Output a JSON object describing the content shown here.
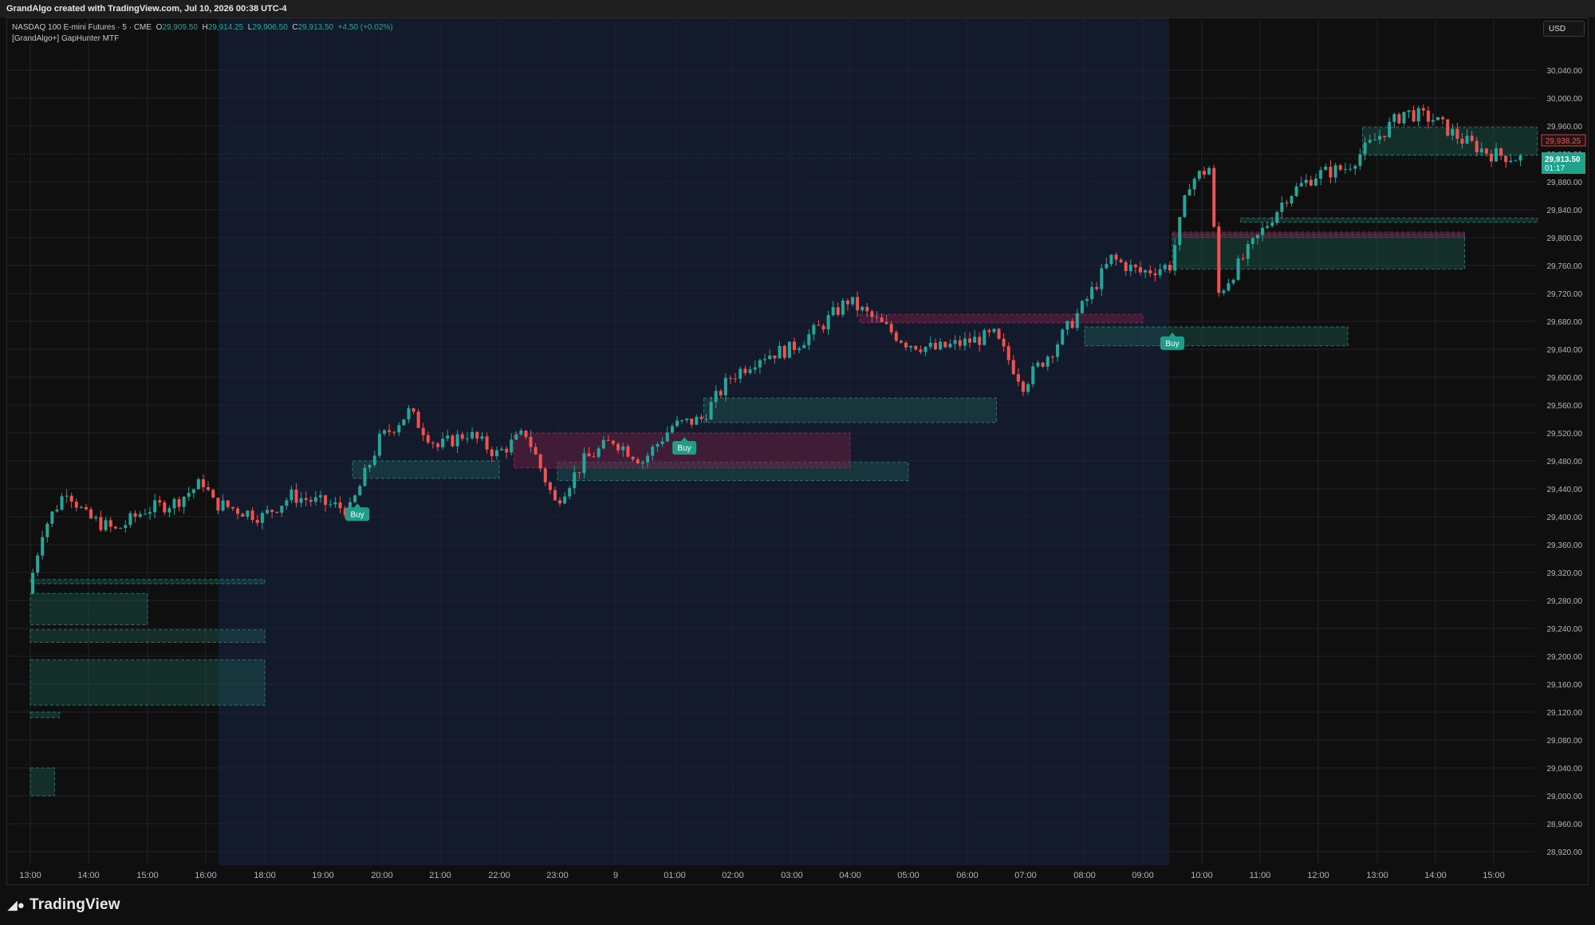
{
  "header": {
    "attribution": "GrandAlgo created with TradingView.com, Jul 10, 2026 00:38 UTC-4"
  },
  "legend": {
    "symbol": "NASDAQ 100 E-mini Futures · 5 · CME",
    "open_label": "O",
    "open": "29,909.50",
    "high_label": "H",
    "high": "29,914.25",
    "low_label": "L",
    "low": "29,906.50",
    "close_label": "C",
    "close": "29,913.50",
    "change": "+4.50 (+0.02%)",
    "indicator": "[GrandAlgo+] GapHunter MTF"
  },
  "currency_button": "USD",
  "footer": {
    "logo_text": "TradingView"
  },
  "price_tags": {
    "red_price": "29,938.25",
    "last_price": "29,913.50",
    "countdown": "01:17"
  },
  "colors": {
    "up": "#26a69a",
    "down": "#ef5350",
    "bull_zone": "#1f6b5c",
    "bear_zone": "#7a1f48",
    "session_bg": "#131a2b",
    "buy_label": "#1f9d89"
  },
  "chart_data": {
    "type": "candlestick",
    "y_axis_labels": [
      "30,040.00",
      "30,000.00",
      "29,960.00",
      "29,920.00",
      "29,880.00",
      "29,840.00",
      "29,800.00",
      "29,760.00",
      "29,720.00",
      "29,680.00",
      "29,640.00",
      "29,600.00",
      "29,560.00",
      "29,520.00",
      "29,480.00",
      "29,440.00",
      "29,400.00",
      "29,360.00",
      "29,320.00",
      "29,280.00",
      "29,240.00",
      "29,200.00",
      "29,160.00",
      "29,120.00",
      "29,080.00",
      "29,040.00",
      "29,000.00",
      "28,960.00",
      "28,920.00"
    ],
    "x_axis_labels": [
      "13:00",
      "14:00",
      "15:00",
      "16:00",
      "18:00",
      "19:00",
      "20:00",
      "21:00",
      "22:00",
      "23:00",
      "9",
      "01:00",
      "02:00",
      "03:00",
      "04:00",
      "05:00",
      "06:00",
      "07:00",
      "08:00",
      "09:00",
      "10:00",
      "11:00",
      "12:00",
      "13:00",
      "14:00",
      "15:00"
    ],
    "ylim": [
      28905,
      30070
    ],
    "path": [
      {
        "t": "13:00",
        "p": 29290
      },
      {
        "t": "13:15",
        "p": 29380
      },
      {
        "t": "13:40",
        "p": 29440
      },
      {
        "t": "14:00",
        "p": 29400
      },
      {
        "t": "14:30",
        "p": 29380
      },
      {
        "t": "15:00",
        "p": 29410
      },
      {
        "t": "15:30",
        "p": 29420
      },
      {
        "t": "16:00",
        "p": 29450
      },
      {
        "t": "16:10",
        "p": 29420
      },
      {
        "t": "18:00",
        "p": 29400
      },
      {
        "t": "18:30",
        "p": 29430
      },
      {
        "t": "19:00",
        "p": 29420
      },
      {
        "t": "19:30",
        "p": 29410
      },
      {
        "t": "20:00",
        "p": 29510
      },
      {
        "t": "20:30",
        "p": 29550
      },
      {
        "t": "21:00",
        "p": 29500
      },
      {
        "t": "21:30",
        "p": 29520
      },
      {
        "t": "22:00",
        "p": 29490
      },
      {
        "t": "22:30",
        "p": 29520
      },
      {
        "t": "23:00",
        "p": 29420
      },
      {
        "t": "23:30",
        "p": 29480
      },
      {
        "t": "9",
        "p": 29510
      },
      {
        "t": "00:30",
        "p": 29480
      },
      {
        "t": "01:00",
        "p": 29530
      },
      {
        "t": "01:30",
        "p": 29540
      },
      {
        "t": "02:00",
        "p": 29600
      },
      {
        "t": "02:30",
        "p": 29630
      },
      {
        "t": "03:00",
        "p": 29640
      },
      {
        "t": "03:30",
        "p": 29670
      },
      {
        "t": "04:00",
        "p": 29710
      },
      {
        "t": "04:20",
        "p": 29690
      },
      {
        "t": "05:00",
        "p": 29650
      },
      {
        "t": "05:30",
        "p": 29640
      },
      {
        "t": "06:00",
        "p": 29650
      },
      {
        "t": "06:30",
        "p": 29660
      },
      {
        "t": "07:00",
        "p": 29590
      },
      {
        "t": "07:30",
        "p": 29640
      },
      {
        "t": "08:00",
        "p": 29700
      },
      {
        "t": "08:30",
        "p": 29770
      },
      {
        "t": "09:00",
        "p": 29750
      },
      {
        "t": "09:30",
        "p": 29760
      },
      {
        "t": "09:50",
        "p": 29880
      },
      {
        "t": "10:10",
        "p": 29900
      },
      {
        "t": "10:20",
        "p": 29720
      },
      {
        "t": "10:40",
        "p": 29760
      },
      {
        "t": "11:00",
        "p": 29800
      },
      {
        "t": "11:30",
        "p": 29860
      },
      {
        "t": "12:00",
        "p": 29890
      },
      {
        "t": "12:30",
        "p": 29900
      },
      {
        "t": "13:00",
        "p": 29940
      },
      {
        "t": "13:30",
        "p": 29980
      },
      {
        "t": "14:00",
        "p": 29970
      },
      {
        "t": "14:30",
        "p": 29940
      },
      {
        "t": "15:00",
        "p": 29920
      },
      {
        "t": "15:30",
        "p": 29914
      }
    ],
    "zones": [
      {
        "kind": "bull",
        "from": "13:00",
        "to": "15:00",
        "top": 29290,
        "bottom": 29245
      },
      {
        "kind": "bull",
        "from": "13:00",
        "to": "18:00",
        "top": 29195,
        "bottom": 29130
      },
      {
        "kind": "bull",
        "from": "13:00",
        "to": "18:00",
        "top": 29238,
        "bottom": 29220
      },
      {
        "kind": "bull",
        "from": "13:00",
        "to": "18:00",
        "top": 29310,
        "bottom": 29304
      },
      {
        "kind": "bull",
        "from": "13:00",
        "to": "13:30",
        "top": 29120,
        "bottom": 29112
      },
      {
        "kind": "bull",
        "from": "13:00",
        "to": "13:25",
        "top": 29040,
        "bottom": 29000
      },
      {
        "kind": "bull",
        "from": "19:30",
        "to": "22:00",
        "top": 29480,
        "bottom": 29455
      },
      {
        "kind": "bull",
        "from": "23:00",
        "to": "05:00",
        "top": 29478,
        "bottom": 29452
      },
      {
        "kind": "bear",
        "from": "22:15",
        "to": "04:00",
        "top": 29520,
        "bottom": 29470
      },
      {
        "kind": "bull",
        "from": "01:30",
        "to": "06:30",
        "top": 29570,
        "bottom": 29535
      },
      {
        "kind": "bear",
        "from": "04:10",
        "to": "09:00",
        "top": 29690,
        "bottom": 29678
      },
      {
        "kind": "bull",
        "from": "09:30",
        "to": "14:30",
        "top": 29805,
        "bottom": 29755
      },
      {
        "kind": "bear",
        "from": "09:30",
        "to": "14:30",
        "top": 29808,
        "bottom": 29800
      },
      {
        "kind": "bull",
        "from": "08:00",
        "to": "12:30",
        "top": 29672,
        "bottom": 29645
      },
      {
        "kind": "bull",
        "from": "12:45",
        "to": "15:45",
        "top": 29958,
        "bottom": 29918
      },
      {
        "kind": "bull",
        "from": "10:40",
        "to": "15:45",
        "top": 29828,
        "bottom": 29822
      }
    ],
    "signals": [
      {
        "label": "Buy",
        "t": "19:35",
        "p": 29410
      },
      {
        "label": "Buy",
        "t": "01:10",
        "p": 29505
      },
      {
        "label": "Buy",
        "t": "09:30",
        "p": 29655
      }
    ]
  }
}
